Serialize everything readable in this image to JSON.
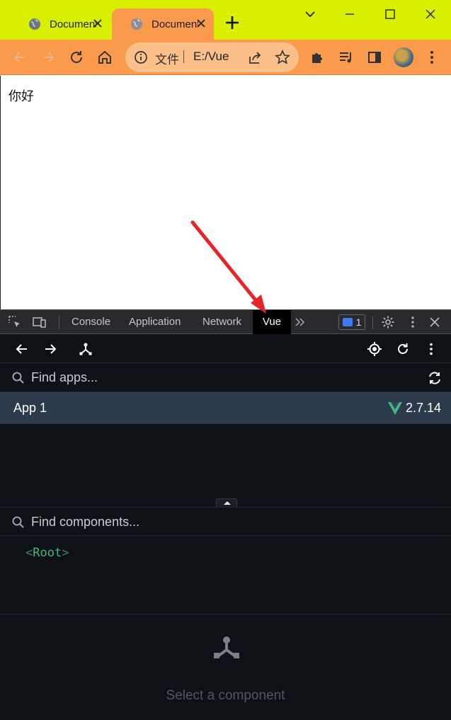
{
  "browser": {
    "tabs": [
      {
        "title": "Document",
        "active": false
      },
      {
        "title": "Document",
        "active": true
      }
    ],
    "omnibox": {
      "scheme_label": "文件",
      "url": "E:/Vue"
    },
    "colors": {
      "tabbar": "#d8f000",
      "toolbar": "#fa9a4c"
    }
  },
  "page": {
    "greeting": "你好"
  },
  "devtools": {
    "tabs": [
      "Console",
      "Application",
      "Network",
      "Vue"
    ],
    "active_tab": "Vue",
    "issues_count": "1"
  },
  "vue_panel": {
    "find_apps_placeholder": "Find apps...",
    "apps": [
      {
        "name": "App 1",
        "version": "2.7.14"
      }
    ],
    "find_components_placeholder": "Find components...",
    "tree": {
      "root_open": "<",
      "root_name": "Root",
      "root_close": ">"
    },
    "empty_hint": "Select a component",
    "colors": {
      "accent": "#42b883",
      "selected_row": "#2c3a4b",
      "background": "#0e1116"
    }
  },
  "annotation": {
    "arrow_color": "#e8232a",
    "points_to": "Vue tab"
  }
}
